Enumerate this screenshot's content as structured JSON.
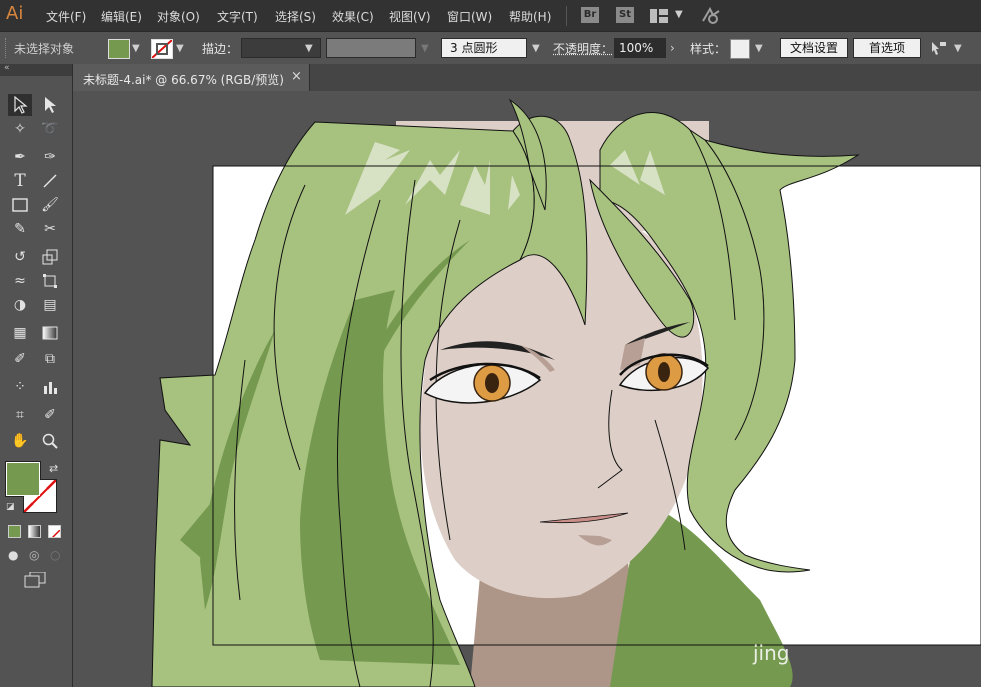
{
  "app": {
    "logo": "Ai"
  },
  "menu": [
    "文件(F)",
    "编辑(E)",
    "对象(O)",
    "文字(T)",
    "选择(S)",
    "效果(C)",
    "视图(V)",
    "窗口(W)",
    "帮助(H)"
  ],
  "bridge_buttons": [
    "Br",
    "St"
  ],
  "control_bar": {
    "selection_status": "未选择对象",
    "stroke_label": "描边：",
    "brush_value": "3 点圆形",
    "opacity_label": "不透明度：",
    "opacity_value": "100%",
    "style_label": "样式：",
    "doc_setup_button": "文档设置",
    "prefs_button": "首选项"
  },
  "document": {
    "tab_title": "未标题-4.ai* @ 66.67% (RGB/预览)",
    "close": "×"
  },
  "watermark": "jing",
  "colors": {
    "hair_light": "#a7c17f",
    "hair_dark": "#74994f",
    "skin": "#ddcfc7",
    "neck": "#ad9587",
    "iris": "#dd9b43",
    "fill_swatch": "#74994f"
  },
  "icons": [
    "selection-tool-icon",
    "direct-selection-tool-icon",
    "magic-wand-icon",
    "lasso-icon",
    "pen-tool-icon",
    "curvature-icon",
    "type-tool-icon",
    "line-tool-icon",
    "rectangle-tool-icon",
    "paintbrush-icon",
    "shaper-icon",
    "scissors-icon",
    "rotate-icon",
    "scale-icon",
    "warp-icon",
    "free-transform-icon",
    "shape-builder-icon",
    "perspective-grid-icon",
    "mesh-icon",
    "gradient-icon",
    "eyedropper-icon",
    "blend-icon",
    "symbol-sprayer-icon",
    "column-graph-icon",
    "artboard-icon",
    "slice-icon",
    "hand-icon",
    "zoom-icon"
  ]
}
